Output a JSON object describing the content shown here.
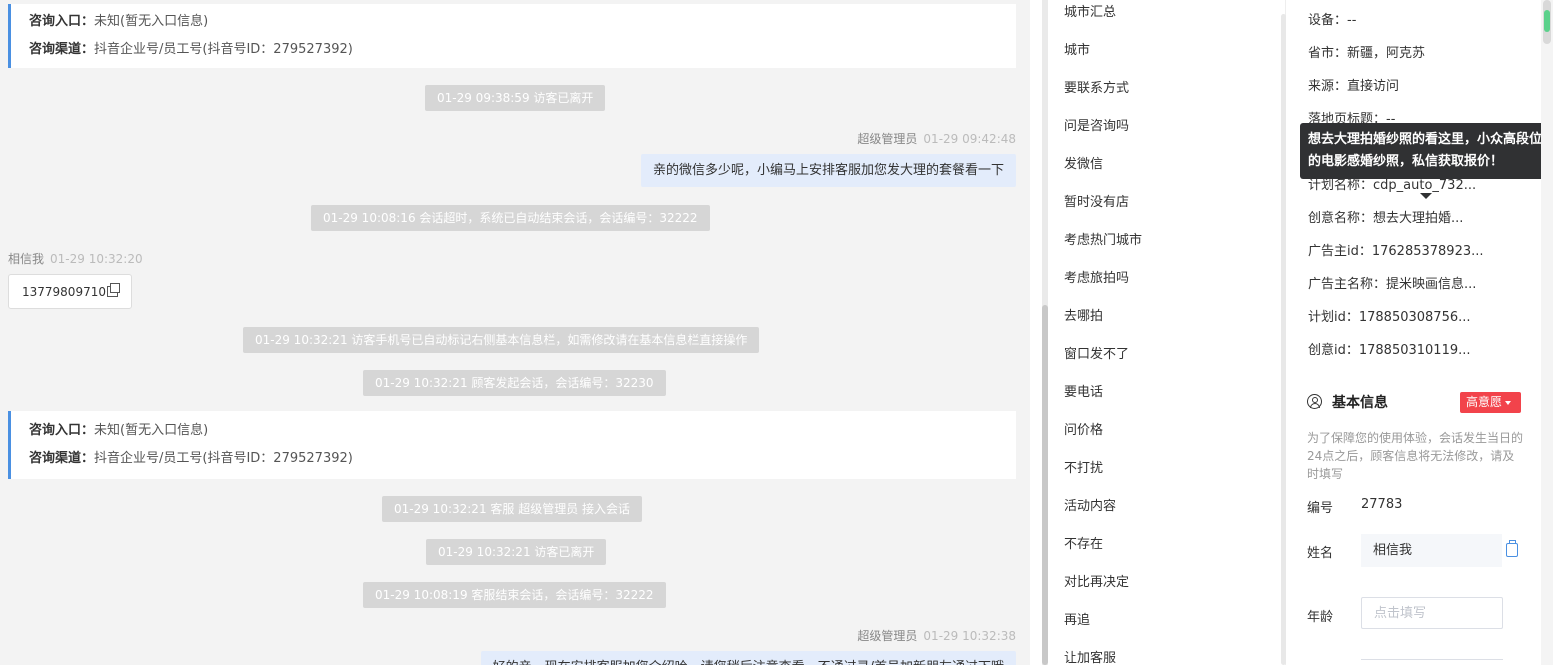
{
  "chat": {
    "info_card_1": {
      "entry_label": "咨询入口：",
      "entry_value": "未知(暂无入口信息)",
      "channel_label": "咨询渠道：",
      "channel_value": "抖音企业号/员工号(抖音号ID：279527392)"
    },
    "sys_1": "01-29 09:38:59 访客已离开",
    "agent_msg_1": {
      "sender": "超级管理员",
      "time": "01-29 09:42:48",
      "text": "亲的微信多少呢，小编马上安排客服加您发大理的套餐看一下"
    },
    "sys_2": "01-29 10:08:16 会话超时，系统已自动结束会话，会话编号：32222",
    "visitor_msg_1": {
      "sender": "相信我",
      "time": "01-29 10:32:20",
      "text": "13779809710"
    },
    "sys_3": "01-29 10:32:21 访客手机号已自动标记右侧基本信息栏，如需修改请在基本信息栏直接操作",
    "sys_4": "01-29 10:32:21 顾客发起会话，会话编号：32230",
    "info_card_2": {
      "entry_label": "咨询入口：",
      "entry_value": "未知(暂无入口信息)",
      "channel_label": "咨询渠道：",
      "channel_value": "抖音企业号/员工号(抖音号ID：279527392)"
    },
    "sys_5": "01-29 10:32:21 客服 超级管理员 接入会话",
    "sys_6": "01-29 10:32:21 访客已离开",
    "sys_7": "01-29 10:08:19 客服结束会话，会话编号：32222",
    "agent_msg_2": {
      "sender": "超级管理员",
      "time": "01-29 10:32:38",
      "text": "好的亲，现在安排客服加您介绍哈，请您稍后注意查看，不通过录/首号加新朋友通过下哦"
    }
  },
  "quick_replies": [
    "城市汇总",
    "城市",
    "要联系方式",
    "问是咨询吗",
    "发微信",
    "暂时没有店",
    "考虑热门城市",
    "考虑旅拍吗",
    "去哪拍",
    "窗口发不了",
    "要电话",
    "问价格",
    "不打扰",
    "活动内容",
    "不存在",
    "对比再决定",
    "再追",
    "让加客服"
  ],
  "visitor_info": {
    "device": "设备：--",
    "province": "省市：新疆，阿克苏",
    "source": "来源：直接访问",
    "landing": "落地页标题：--",
    "plan_name": "计划名称：cdp_auto_732...",
    "creative_name": "创意名称：想去大理拍婚...",
    "advertiser_id": "广告主id：176285378923...",
    "advertiser_name": "广告主名称：提米映画信息...",
    "plan_id": "计划id：178850308756...",
    "creative_id": "创意id：178850310119..."
  },
  "tooltip": "想去大理拍婚纱照的看这里，小众高段位的电影感婚纱照，私信获取报价！",
  "basic_info": {
    "title": "基本信息",
    "intent": "高意愿",
    "notice": "为了保障您的使用体验，会话发生当日的24点之后，顾客信息将无法修改，请及时填写",
    "id_label": "编号",
    "id_value": "27783",
    "name_label": "姓名",
    "name_value": "相信我",
    "age_label": "年龄",
    "age_placeholder": "点击填写"
  }
}
